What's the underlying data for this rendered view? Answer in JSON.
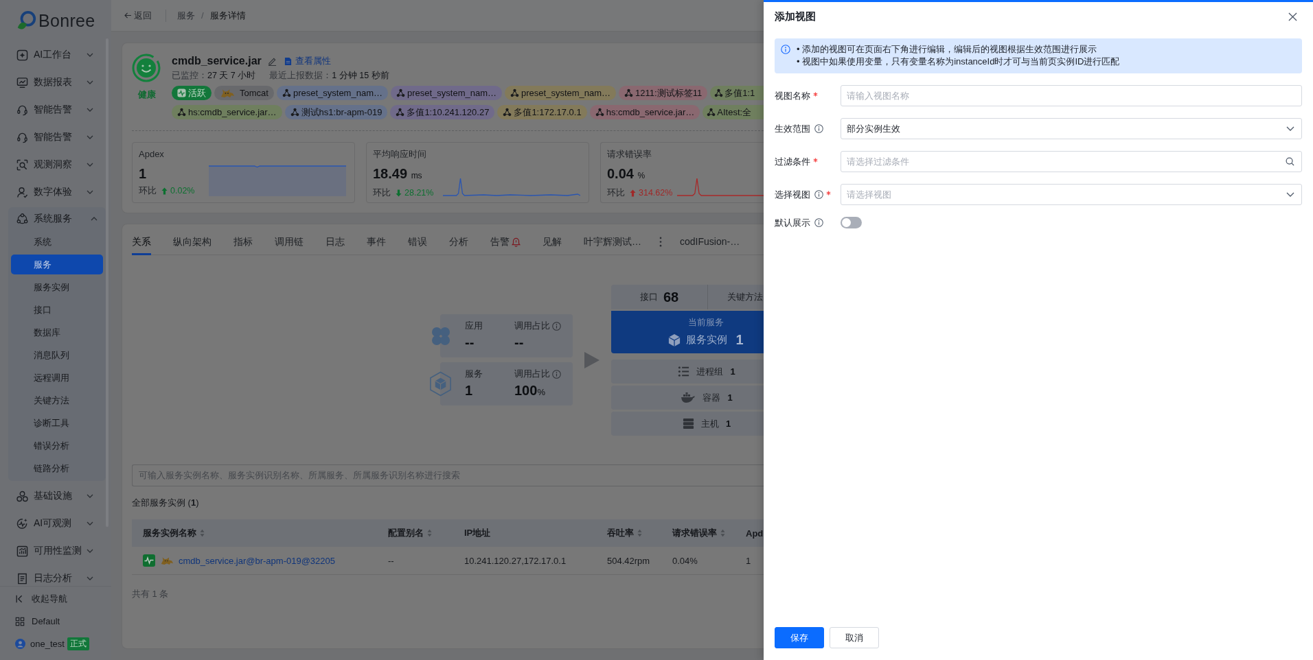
{
  "sidebar": {
    "logo": "Bonree",
    "items": [
      {
        "label": "AI工作台",
        "expanded": false
      },
      {
        "label": "数据报表",
        "expanded": false
      },
      {
        "label": "智能告警",
        "expanded": false
      },
      {
        "label": "智能告警",
        "expanded": false
      },
      {
        "label": "观测洞察",
        "expanded": false
      },
      {
        "label": "数字体验",
        "expanded": false
      },
      {
        "label": "系统服务",
        "expanded": true,
        "children": [
          {
            "label": "系统",
            "selected": false
          },
          {
            "label": "服务",
            "selected": true
          },
          {
            "label": "服务实例",
            "selected": false
          },
          {
            "label": "接口",
            "selected": false
          },
          {
            "label": "数据库",
            "selected": false
          },
          {
            "label": "消息队列",
            "selected": false
          },
          {
            "label": "远程调用",
            "selected": false
          },
          {
            "label": "关键方法",
            "selected": false
          },
          {
            "label": "诊断工具",
            "selected": false
          },
          {
            "label": "错误分析",
            "selected": false
          },
          {
            "label": "链路分析",
            "selected": false
          }
        ]
      },
      {
        "label": "基础设施",
        "expanded": false
      },
      {
        "label": "AI可观测",
        "expanded": false
      },
      {
        "label": "可用性监测",
        "expanded": false
      },
      {
        "label": "日志分析",
        "expanded": false
      }
    ],
    "footer": [
      {
        "kind": "collapse",
        "label": "收起导航"
      },
      {
        "kind": "workspace",
        "label": "Default"
      },
      {
        "kind": "user",
        "label": "one_test",
        "badge": "正式"
      }
    ]
  },
  "breadcrumb": {
    "back": "返回",
    "separator": "/",
    "items": [
      "服务",
      "服务详情"
    ]
  },
  "service": {
    "health": "健康",
    "name": "cmdb_service.jar",
    "properties_link": "查看属性",
    "meta": [
      {
        "label": "已监控：",
        "value": "27 天 7 小时"
      },
      {
        "label": "最近上报数据：",
        "value": "1 分钟 15 秒前"
      }
    ],
    "tag_rows": [
      [
        {
          "kind": "status",
          "label": "活跃",
          "color": "#12773a"
        },
        {
          "kind": "tech",
          "label": "Tomcat",
          "color": "#68696c"
        },
        {
          "kind": "label",
          "label": "preset_system_nam…",
          "color": "#65718a"
        },
        {
          "kind": "label",
          "label": "preset_system_nam…",
          "color": "#706a8a"
        },
        {
          "kind": "label",
          "label": "preset_system_nam…",
          "color": "#837a5a"
        },
        {
          "kind": "label",
          "label": "1211:测试标签11",
          "color": "#8a6870"
        },
        {
          "kind": "label",
          "label": "多值1:1",
          "color": "#6f7f5e"
        }
      ],
      [
        {
          "kind": "label",
          "label": "hs:cmdb_service.jar…",
          "color": "#6f7f5e"
        },
        {
          "kind": "label",
          "label": "测试hs1:br-apm-019",
          "color": "#65718a"
        },
        {
          "kind": "label",
          "label": "多值1:10.241.120.27",
          "color": "#706a8a"
        },
        {
          "kind": "label",
          "label": "多值1:172.17.0.1",
          "color": "#837a5a"
        },
        {
          "kind": "label",
          "label": "hs:cmdb_service.jar…",
          "color": "#8a6870"
        },
        {
          "kind": "label",
          "label": "AItest:全",
          "color": "#6f7f5e"
        }
      ]
    ]
  },
  "metrics": [
    {
      "title": "Apdex",
      "value": "1",
      "compare_label": "环比",
      "increase": true,
      "good": true,
      "change": "0.02%"
    },
    {
      "title": "平均响应时间",
      "value": "18.49",
      "unit": "ms",
      "compare_label": "环比",
      "increase": false,
      "good": true,
      "change": "28.21%"
    },
    {
      "title": "请求错误率",
      "value": "0.04",
      "unit": "%",
      "compare_label": "环比",
      "increase": true,
      "good": false,
      "change": "314.62%"
    }
  ],
  "tabs": [
    {
      "label": "关系",
      "selected": true,
      "alert": false
    },
    {
      "label": "纵向架构",
      "selected": false,
      "alert": false
    },
    {
      "label": "指标",
      "selected": false,
      "alert": false
    },
    {
      "label": "调用链",
      "selected": false,
      "alert": false
    },
    {
      "label": "日志",
      "selected": false,
      "alert": false
    },
    {
      "label": "事件",
      "selected": false,
      "alert": false
    },
    {
      "label": "错误",
      "selected": false,
      "alert": false
    },
    {
      "label": "分析",
      "selected": false,
      "alert": false
    },
    {
      "label": "告警",
      "selected": false,
      "alert": true
    },
    {
      "label": "见解",
      "selected": false,
      "alert": false
    },
    {
      "label": "叶宇辉测试…",
      "selected": false,
      "alert": false
    }
  ],
  "more_tabs": [
    {
      "label": "codIFusion-…",
      "selected": false,
      "alert": false
    }
  ],
  "relation": {
    "upstream": [
      {
        "label": "应用",
        "value": "--",
        "share_label": "调用占比",
        "share_value": "--"
      },
      {
        "label": "服务",
        "value": "1",
        "share_label": "调用占比",
        "share_value": "100",
        "share_unit": "%"
      }
    ],
    "summary": [
      {
        "label": "接口",
        "value": "68"
      },
      {
        "label": "关键方法"
      }
    ],
    "current": {
      "title": "当前服务",
      "label": "服务实例",
      "value": "1"
    },
    "resources": [
      {
        "label": "进程组",
        "value": "1"
      },
      {
        "label": "容器",
        "value": "1"
      },
      {
        "label": "主机",
        "value": "1"
      }
    ]
  },
  "instances": {
    "search_placeholder": "可输入服务实例名称、服务实例识别名称、所属服务、所属服务识别名称进行搜索",
    "title": "全部服务实例 (**1**)",
    "columns": [
      {
        "label": "服务实例名称",
        "sortable": true
      },
      {
        "label": "配置别名",
        "sortable": true
      },
      {
        "label": "IP地址",
        "sortable": false
      },
      {
        "label": "吞吐率",
        "sortable": true
      },
      {
        "label": "请求错误率",
        "sortable": true
      },
      {
        "label": "Apd",
        "sortable": false
      }
    ],
    "rows": [
      {
        "cells": [
          "cmdb_service.jar@br-apm-019@32205",
          "--",
          "10.241.120.27,172.17.0.1",
          "504.42rpm",
          "0.04%",
          "1"
        ]
      }
    ],
    "total": "共有 1 条"
  },
  "drawer": {
    "title": "添加视图",
    "notice": [
      "• 添加的视图可在页面右下角进行编辑，编辑后的视图根据生效范围进行展示",
      "• 视图中如果使用变量，只有变量名称为instanceId时才可与当前页实例ID进行匹配"
    ],
    "fields": [
      {
        "label": "视图名称",
        "required": true,
        "info": false,
        "kind": "input",
        "placeholder": "请输入视图名称"
      },
      {
        "label": "生效范围",
        "required": false,
        "info": true,
        "kind": "select",
        "value": "部分实例生效"
      },
      {
        "label": "过滤条件",
        "required": true,
        "info": false,
        "kind": "search",
        "placeholder": "请选择过滤条件"
      },
      {
        "label": "选择视图",
        "required": true,
        "info": true,
        "kind": "select",
        "placeholder": "请选择视图"
      },
      {
        "label": "默认展示",
        "required": false,
        "info": true,
        "kind": "switch",
        "on": false
      }
    ],
    "buttons": [
      {
        "label": "保存",
        "kind": "primary"
      },
      {
        "label": "取消",
        "kind": "default"
      }
    ]
  }
}
